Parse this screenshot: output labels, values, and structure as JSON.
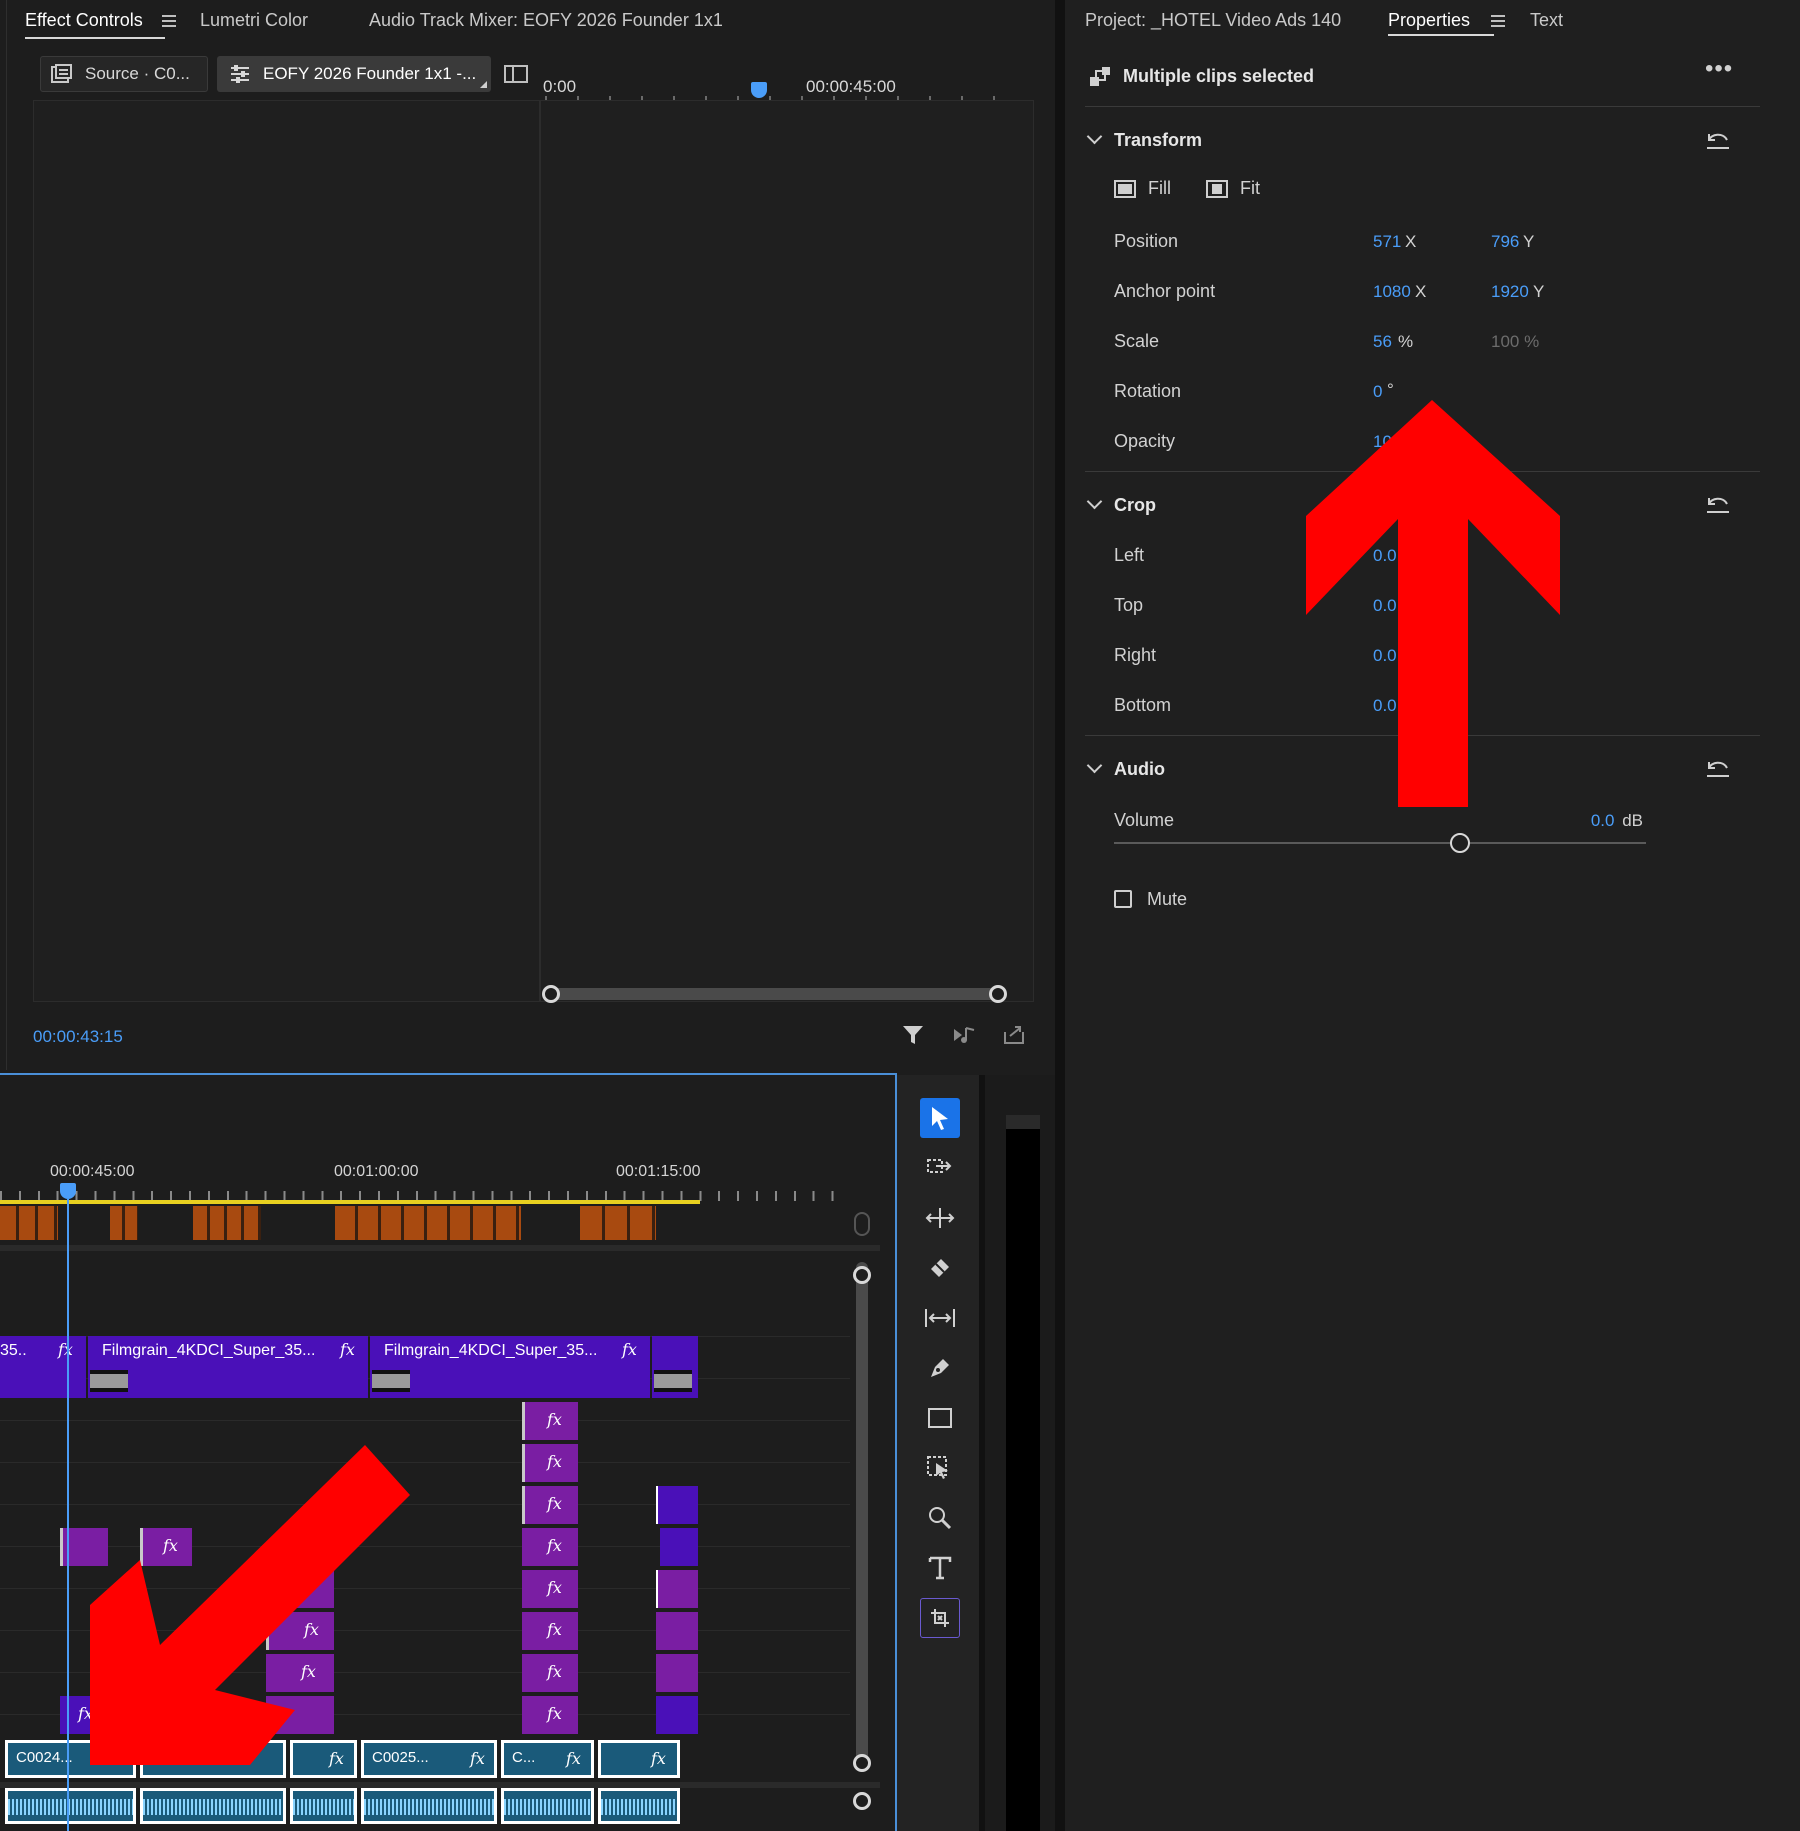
{
  "top_left_tabs": [
    "Effect Controls",
    "Lumetri Color",
    "Audio Track Mixer: EOFY 2026 Founder 1x1"
  ],
  "top_right_tabs": [
    "Project: _HOTEL Video Ads 140",
    "Properties",
    "Text"
  ],
  "effect_controls": {
    "source_tab": "Source · C0...",
    "sequence_tab": "EOFY 2026 Founder 1x1 -...",
    "ruler_start": "0:00",
    "ruler_mid": "00:00:45:00",
    "current_time": "00:00:43:15"
  },
  "properties": {
    "header": "Multiple clips selected",
    "transform": {
      "title": "Transform",
      "fill_label": "Fill",
      "fit_label": "Fit",
      "position": {
        "label": "Position",
        "x": "571",
        "y": "796",
        "x_unit": "X",
        "y_unit": "Y"
      },
      "anchor": {
        "label": "Anchor point",
        "x": "1080",
        "y": "1920",
        "x_unit": "X",
        "y_unit": "Y"
      },
      "scale": {
        "label": "Scale",
        "value": "56",
        "unit": "%",
        "secondary": "100 %"
      },
      "rotation": {
        "label": "Rotation",
        "value": "0",
        "unit": "°"
      },
      "opacity": {
        "label": "Opacity",
        "value": "10"
      }
    },
    "crop": {
      "title": "Crop",
      "rows": [
        {
          "label": "Left",
          "value": "0.0"
        },
        {
          "label": "Top",
          "value": "0.0"
        },
        {
          "label": "Right",
          "value": "0.0"
        },
        {
          "label": "Bottom",
          "value": "0.0"
        }
      ]
    },
    "audio": {
      "title": "Audio",
      "volume_label": "Volume",
      "volume_value": "0.0",
      "volume_unit": "dB",
      "volume_level": 0.65,
      "mute_label": "Mute"
    }
  },
  "timeline": {
    "ruler_labels": [
      "00:00:45:00",
      "00:01:00:00",
      "00:01:15:00"
    ],
    "clip_labels": {
      "v_top_left": "35..",
      "filmgrain_1": "Filmgrain_4KDCI_Super_35...",
      "filmgrain_2": "Filmgrain_4KDCI_Super_35...",
      "c0024": "C0024...",
      "c0025": "C0025...",
      "c_short": "C..."
    },
    "fx_label": "fx"
  },
  "colors": {
    "accent_blue": "#4a9df8",
    "clip_purple": "#4a10b8",
    "clip_magenta": "#7a1ea3",
    "clip_teal": "#1a5a7a",
    "marker_orange": "#a84a10",
    "annotation_red": "#ff0000"
  },
  "icons": [
    "pages-icon",
    "sequence-icon",
    "panel-toggle-icon",
    "filter-icon",
    "play-audio-icon",
    "export-icon",
    "multi-clip-icon",
    "more-icon",
    "reset-icon",
    "selection-tool-icon",
    "track-select-icon",
    "ripple-edit-icon",
    "razor-icon",
    "slip-icon",
    "pen-icon",
    "rectangle-icon",
    "hand-icon",
    "zoom-icon",
    "type-icon",
    "remix-icon"
  ]
}
